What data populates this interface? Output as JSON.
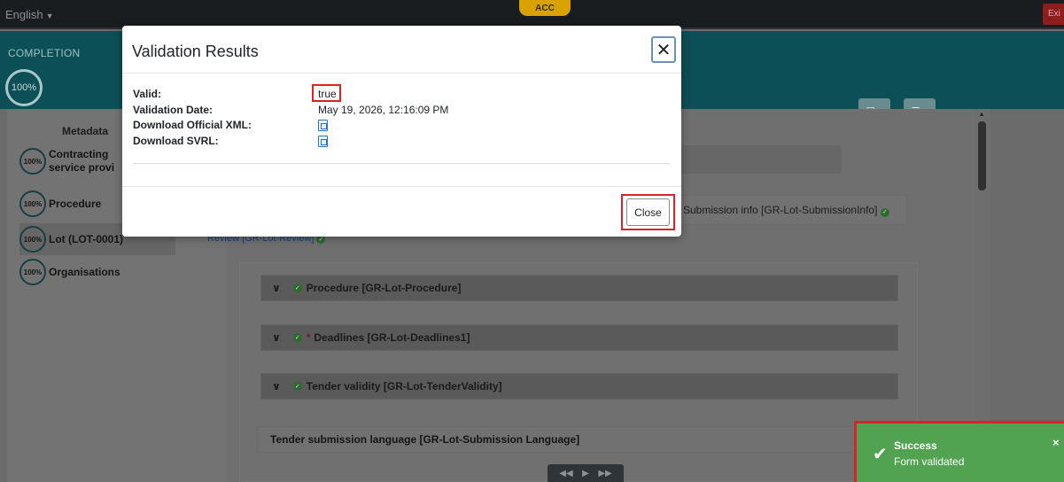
{
  "topbar": {
    "language": "English",
    "env_badge": "ACC",
    "exit_label": "Exi"
  },
  "completion": {
    "label": "COMPLETION",
    "percent": "100%"
  },
  "sidebar": {
    "metadata_label": "Metadata",
    "items": [
      {
        "badge": "100%",
        "line1": "Contracting",
        "line2": "service provi"
      },
      {
        "badge": "100%",
        "line1": "Procedure"
      },
      {
        "badge": "100%",
        "line1": "Lot (LOT-0001)"
      },
      {
        "badge": "100%",
        "line1": "Organisations"
      }
    ]
  },
  "content": {
    "submission_tab": "Submission info  [GR-Lot-SubmissionInfo]",
    "review_link": "Review  [GR-Lot-Review]",
    "sections": [
      {
        "label": "Procedure  [GR-Lot-Procedure]",
        "required": false
      },
      {
        "label": "Deadlines  [GR-Lot-Deadlines1]",
        "required": true
      },
      {
        "label": "Tender validity  [GR-Lot-TenderValidity]",
        "required": false
      }
    ],
    "tender_language": "Tender submission language  [GR-Lot-Submission Language]"
  },
  "modal": {
    "title": "Validation Results",
    "close_label": "Close",
    "rows": [
      {
        "label": "Valid:",
        "value": "true"
      },
      {
        "label": "Validation Date:",
        "value": "May 19, 2026, 12:16:09 PM"
      },
      {
        "label": "Download Official XML:",
        "icon": "xml-file-icon"
      },
      {
        "label": "Download SVRL:",
        "icon": "svrl-file-icon"
      }
    ]
  },
  "toast": {
    "title": "Success",
    "message": "Form validated",
    "type": "success",
    "color": "#51a351"
  },
  "colors": {
    "highlight": "#d9232b",
    "teal": "#0c4f56"
  }
}
